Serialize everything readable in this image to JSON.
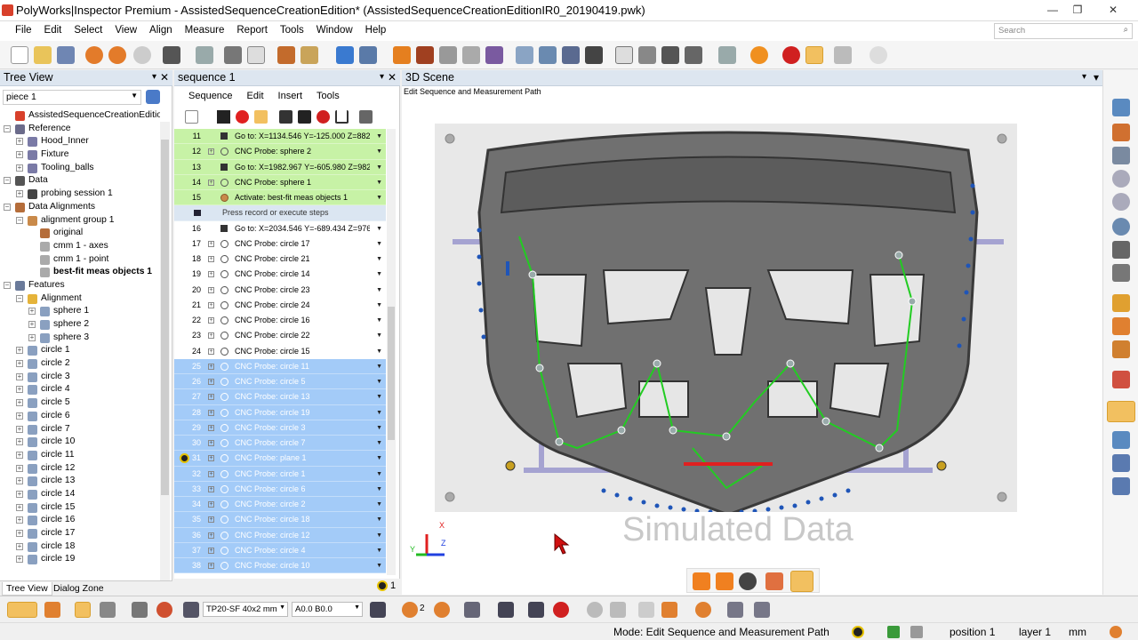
{
  "window": {
    "title": "PolyWorks|Inspector Premium - AssistedSequenceCreationEdition* (AssistedSequenceCreationEditionIR0_20190419.pwk)"
  },
  "menu": [
    "File",
    "Edit",
    "Select",
    "View",
    "Align",
    "Measure",
    "Report",
    "Tools",
    "Window",
    "Help"
  ],
  "search": {
    "placeholder": "Search"
  },
  "tree_view": {
    "title": "Tree View",
    "piece": "piece 1",
    "tabs": [
      "Tree View",
      "Dialog Zone"
    ],
    "items": [
      {
        "label": "AssistedSequenceCreationEdition - (",
        "level": 0,
        "exp": "",
        "icon": "#d8402b"
      },
      {
        "label": "Reference",
        "level": 0,
        "exp": "−",
        "icon": "#6b6b8a"
      },
      {
        "label": "Hood_Inner",
        "level": 1,
        "exp": "+",
        "icon": "#7a7aa6"
      },
      {
        "label": "Fixture",
        "level": 1,
        "exp": "+",
        "icon": "#7a7aa6"
      },
      {
        "label": "Tooling_balls",
        "level": 1,
        "exp": "+",
        "icon": "#7a7aa6"
      },
      {
        "label": "Data",
        "level": 0,
        "exp": "−",
        "icon": "#555"
      },
      {
        "label": "probing session 1",
        "level": 1,
        "exp": "+",
        "icon": "#444"
      },
      {
        "label": "Data Alignments",
        "level": 0,
        "exp": "−",
        "icon": "#b56d3a"
      },
      {
        "label": "alignment group 1",
        "level": 1,
        "exp": "−",
        "icon": "#c98a4a"
      },
      {
        "label": "original",
        "level": 2,
        "exp": "",
        "icon": "#b56d3a"
      },
      {
        "label": "cmm 1 - axes",
        "level": 2,
        "exp": "",
        "icon": "#aaa"
      },
      {
        "label": "cmm 1 - point",
        "level": 2,
        "exp": "",
        "icon": "#aaa"
      },
      {
        "label": "best-fit meas objects 1",
        "level": 2,
        "exp": "",
        "icon": "#aaa",
        "bold": true
      },
      {
        "label": "Features",
        "level": 0,
        "exp": "−",
        "icon": "#6a7a9a"
      },
      {
        "label": "Alignment",
        "level": 1,
        "exp": "−",
        "icon": "#e5b33a"
      },
      {
        "label": "sphere 1",
        "level": 2,
        "exp": "+",
        "icon": "#8aa0c0"
      },
      {
        "label": "sphere 2",
        "level": 2,
        "exp": "+",
        "icon": "#8aa0c0"
      },
      {
        "label": "sphere 3",
        "level": 2,
        "exp": "+",
        "icon": "#8aa0c0"
      },
      {
        "label": "circle 1",
        "level": 1,
        "exp": "+",
        "icon": "#8aa0c0"
      },
      {
        "label": "circle 2",
        "level": 1,
        "exp": "+",
        "icon": "#8aa0c0"
      },
      {
        "label": "circle 3",
        "level": 1,
        "exp": "+",
        "icon": "#8aa0c0"
      },
      {
        "label": "circle 4",
        "level": 1,
        "exp": "+",
        "icon": "#8aa0c0"
      },
      {
        "label": "circle 5",
        "level": 1,
        "exp": "+",
        "icon": "#8aa0c0"
      },
      {
        "label": "circle 6",
        "level": 1,
        "exp": "+",
        "icon": "#8aa0c0"
      },
      {
        "label": "circle 7",
        "level": 1,
        "exp": "+",
        "icon": "#8aa0c0"
      },
      {
        "label": "circle 10",
        "level": 1,
        "exp": "+",
        "icon": "#8aa0c0"
      },
      {
        "label": "circle 11",
        "level": 1,
        "exp": "+",
        "icon": "#8aa0c0"
      },
      {
        "label": "circle 12",
        "level": 1,
        "exp": "+",
        "icon": "#8aa0c0"
      },
      {
        "label": "circle 13",
        "level": 1,
        "exp": "+",
        "icon": "#8aa0c0"
      },
      {
        "label": "circle 14",
        "level": 1,
        "exp": "+",
        "icon": "#8aa0c0"
      },
      {
        "label": "circle 15",
        "level": 1,
        "exp": "+",
        "icon": "#8aa0c0"
      },
      {
        "label": "circle 16",
        "level": 1,
        "exp": "+",
        "icon": "#8aa0c0"
      },
      {
        "label": "circle 17",
        "level": 1,
        "exp": "+",
        "icon": "#8aa0c0"
      },
      {
        "label": "circle 18",
        "level": 1,
        "exp": "+",
        "icon": "#8aa0c0"
      },
      {
        "label": "circle 19",
        "level": 1,
        "exp": "+",
        "icon": "#8aa0c0"
      }
    ]
  },
  "sequence": {
    "title": "sequence 1",
    "menu": [
      "Sequence",
      "Edit",
      "Insert",
      "Tools"
    ],
    "rows": [
      {
        "n": "11",
        "label": "Go to: X=1134.546 Y=-125.000 Z=882.9...",
        "state": "g",
        "plus": false
      },
      {
        "n": "12",
        "label": "CNC Probe: sphere 2",
        "state": "g",
        "plus": true
      },
      {
        "n": "13",
        "label": "Go to: X=1982.967 Y=-605.980 Z=982.9...",
        "state": "g",
        "plus": false
      },
      {
        "n": "14",
        "label": "CNC Probe: sphere 1",
        "state": "g",
        "plus": true
      },
      {
        "n": "15",
        "label": "Activate: best-fit meas objects 1",
        "state": "g",
        "plus": false
      },
      {
        "n": "",
        "label": "Press record or execute steps",
        "state": "p",
        "plus": false
      },
      {
        "n": "16",
        "label": "Go to: X=2034.546 Y=-689.434 Z=976.1...",
        "state": "w",
        "plus": false
      },
      {
        "n": "17",
        "label": "CNC Probe: circle 17",
        "state": "w",
        "plus": true
      },
      {
        "n": "18",
        "label": "CNC Probe: circle 21",
        "state": "w",
        "plus": true
      },
      {
        "n": "19",
        "label": "CNC Probe: circle 14",
        "state": "w",
        "plus": true
      },
      {
        "n": "20",
        "label": "CNC Probe: circle 23",
        "state": "w",
        "plus": true
      },
      {
        "n": "21",
        "label": "CNC Probe: circle 24",
        "state": "w",
        "plus": true
      },
      {
        "n": "22",
        "label": "CNC Probe: circle 16",
        "state": "w",
        "plus": true
      },
      {
        "n": "23",
        "label": "CNC Probe: circle 22",
        "state": "w",
        "plus": true
      },
      {
        "n": "24",
        "label": "CNC Probe: circle 15",
        "state": "w",
        "plus": true
      },
      {
        "n": "25",
        "label": "CNC Probe: circle 11",
        "state": "b",
        "plus": true
      },
      {
        "n": "26",
        "label": "CNC Probe: circle 5",
        "state": "b",
        "plus": true
      },
      {
        "n": "27",
        "label": "CNC Probe: circle 13",
        "state": "b",
        "plus": true
      },
      {
        "n": "28",
        "label": "CNC Probe: circle 19",
        "state": "b",
        "plus": true
      },
      {
        "n": "29",
        "label": "CNC Probe: circle 3",
        "state": "b",
        "plus": true
      },
      {
        "n": "30",
        "label": "CNC Probe: circle 7",
        "state": "b",
        "plus": true
      },
      {
        "n": "31",
        "label": "CNC Probe: plane 1",
        "state": "b",
        "plus": true,
        "marker": true
      },
      {
        "n": "32",
        "label": "CNC Probe: circle 1",
        "state": "b",
        "plus": true
      },
      {
        "n": "33",
        "label": "CNC Probe: circle 6",
        "state": "b",
        "plus": true
      },
      {
        "n": "34",
        "label": "CNC Probe: circle 2",
        "state": "b",
        "plus": true
      },
      {
        "n": "35",
        "label": "CNC Probe: circle 18",
        "state": "b",
        "plus": true
      },
      {
        "n": "36",
        "label": "CNC Probe: circle 12",
        "state": "b",
        "plus": true
      },
      {
        "n": "37",
        "label": "CNC Probe: circle 4",
        "state": "b",
        "plus": true
      },
      {
        "n": "38",
        "label": "CNC Probe: circle 10",
        "state": "b",
        "plus": true
      }
    ],
    "footer_count": "1"
  },
  "scene": {
    "title": "3D Scene",
    "subtitle": "Edit Sequence and Measurement Path",
    "watermark": "Simulated Data",
    "axis_labels": {
      "x": "X",
      "y": "Y",
      "z": "Z"
    }
  },
  "bottom": {
    "probe": "TP20-SF 40x2 mm",
    "angle": "A0.0 B0.0",
    "count2": "2"
  },
  "status": {
    "mode": "Mode: Edit Sequence and Measurement Path",
    "position": "position 1",
    "layer": "layer 1",
    "unit": "mm"
  },
  "colors": {
    "green_row": "#c7f2a6",
    "blue_row": "#a3cbf8",
    "path_green": "#22cc22",
    "blue_marker": "#1f55b8"
  }
}
